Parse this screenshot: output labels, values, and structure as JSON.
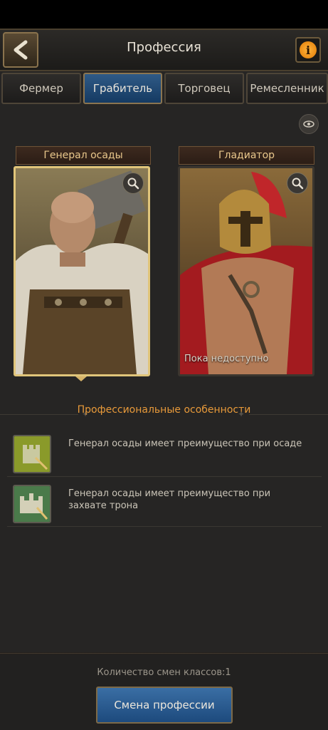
{
  "header": {
    "title": "Профессия",
    "info_symbol": "i"
  },
  "tabs": [
    {
      "label": "Фермер",
      "active": false
    },
    {
      "label": "Грабитель",
      "active": true
    },
    {
      "label": "Торговец",
      "active": false
    },
    {
      "label": "Ремесленник",
      "active": false
    }
  ],
  "classes": [
    {
      "name": "Генерал осады",
      "selected": true,
      "note": ""
    },
    {
      "name": "Гладиатор",
      "selected": false,
      "note": "Пока недоступно"
    }
  ],
  "features": {
    "title": "Профессиональные особенности",
    "items": [
      {
        "icon": "siege-castle-icon",
        "text": "Генерал осады имеет преимущество при осаде"
      },
      {
        "icon": "throne-castle-icon",
        "text": "Генерал осады имеет преимущество при захвате трона"
      }
    ]
  },
  "footer": {
    "swap_count": "Количество смен классов:1",
    "change_button": "Смена профессии"
  },
  "colors": {
    "accent": "#e89a3a",
    "button_blue": "#2a5c91",
    "gold_border": "#e0c57a"
  }
}
